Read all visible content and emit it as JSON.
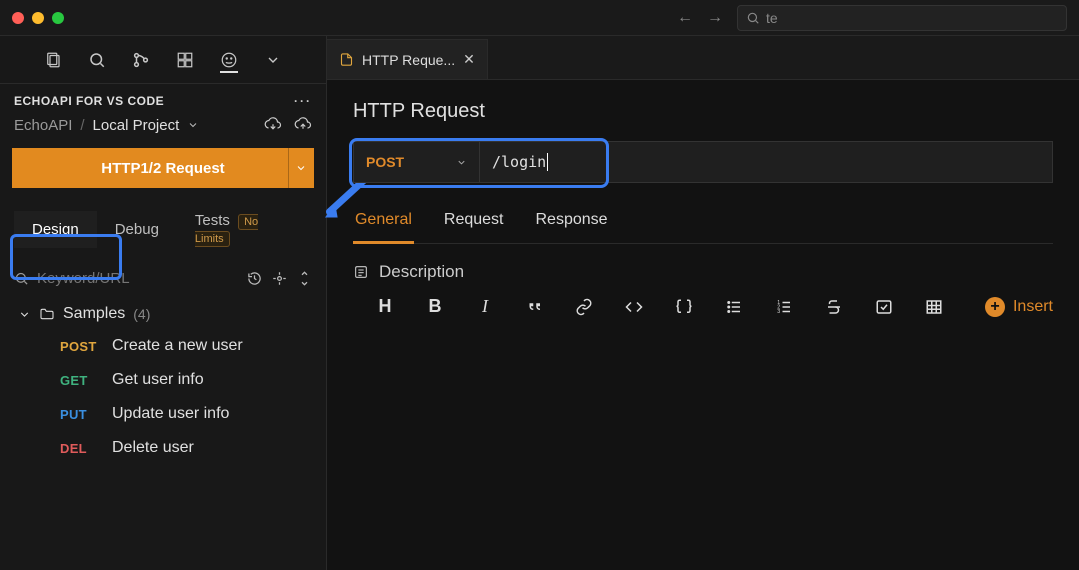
{
  "titlebar": {
    "search_placeholder": "te",
    "search_icon": "search-icon"
  },
  "sidebar": {
    "extension_title": "ECHOAPI FOR VS CODE",
    "product": "EchoAPI",
    "project": "Local Project",
    "new_request_label": "HTTP1/2 Request",
    "tabs": {
      "design": "Design",
      "debug": "Debug",
      "tests": "Tests",
      "tests_badge": "No Limits"
    },
    "filter_placeholder": "Keyword/URL",
    "folder": {
      "name": "Samples",
      "count": "(4)"
    },
    "items": [
      {
        "method": "POST",
        "label": "Create a new user",
        "mclass": "m-post"
      },
      {
        "method": "GET",
        "label": "Get user info",
        "mclass": "m-get"
      },
      {
        "method": "PUT",
        "label": "Update user info",
        "mclass": "m-put"
      },
      {
        "method": "DEL",
        "label": "Delete user",
        "mclass": "m-del"
      }
    ]
  },
  "main": {
    "tab_label": "HTTP Reque...",
    "title": "HTTP Request",
    "method": "POST",
    "url": "/login",
    "tabs": {
      "general": "General",
      "request": "Request",
      "response": "Response"
    },
    "description_label": "Description",
    "insert_label": "Insert"
  }
}
